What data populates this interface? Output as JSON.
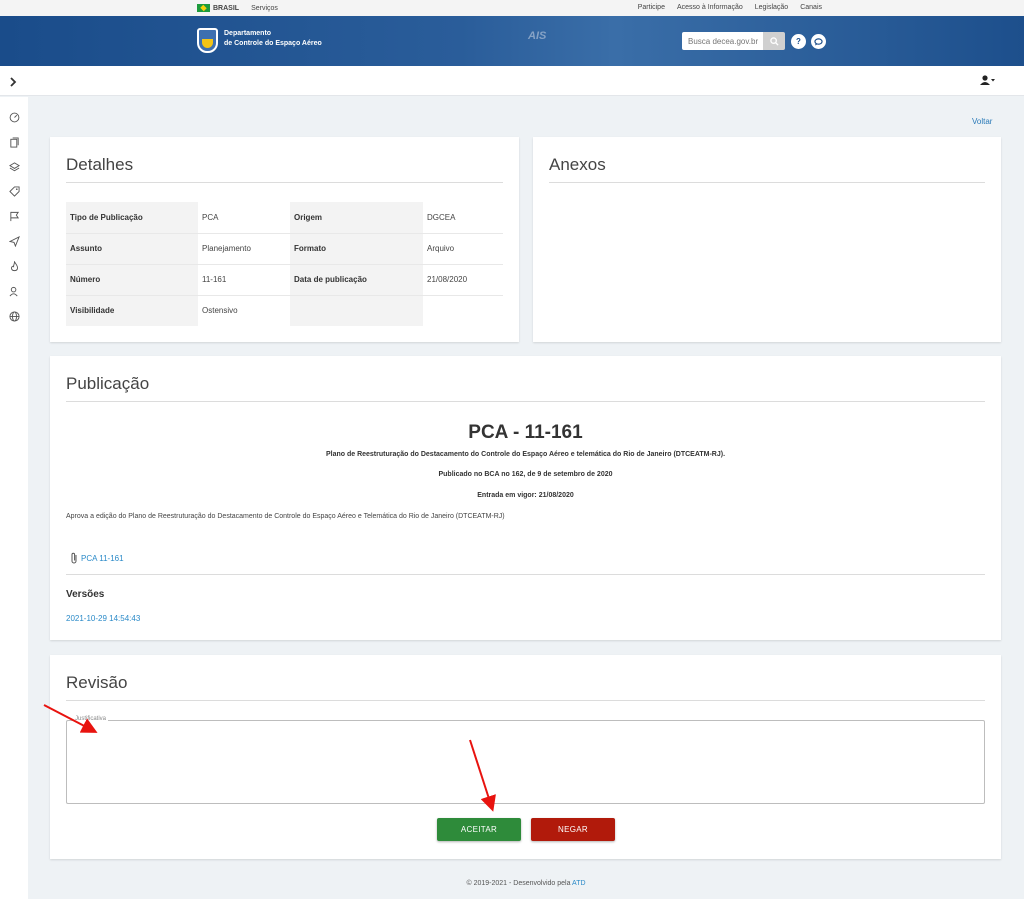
{
  "govbar": {
    "brasil": "BRASIL",
    "servicos": "Serviços",
    "links": [
      "Participe",
      "Acesso à Informação",
      "Legislação",
      "Canais"
    ]
  },
  "header": {
    "brand_line1": "Departamento",
    "brand_line2": "de Controle do Espaço Aéreo",
    "ais": "AIS",
    "search_placeholder": "Busca decea.gov.br",
    "help_label": "?",
    "chat_label": "💬"
  },
  "appbar": {
    "toggle_icon": "chevron-right-icon",
    "user_icon": "user-icon"
  },
  "sidebar_icons": [
    "dashboard-icon",
    "documents-icon",
    "layers-icon",
    "tag-icon",
    "flag-icon",
    "send-icon",
    "fire-icon",
    "user-group-icon",
    "globe-icon"
  ],
  "voltar": "Voltar",
  "detalhes": {
    "title": "Detalhes",
    "rows": [
      {
        "k1": "Tipo de Publicação",
        "v1": "PCA",
        "k2": "Origem",
        "v2": "DGCEA"
      },
      {
        "k1": "Assunto",
        "v1": "Planejamento",
        "k2": "Formato",
        "v2": "Arquivo"
      },
      {
        "k1": "Número",
        "v1": "11-161",
        "k2": "Data de publicação",
        "v2": "21/08/2020"
      },
      {
        "k1": "Visibilidade",
        "v1": "Ostensivo",
        "k2": "",
        "v2": ""
      }
    ]
  },
  "anexos": {
    "title": "Anexos"
  },
  "publicacao": {
    "title": "Publicação",
    "doc_title": "PCA - 11-161",
    "subtitle": "Plano de Reestruturação do Destacamento do Controle do Espaço Aéreo e telemática do Rio de Janeiro (DTCEATM-RJ).",
    "published": "Publicado no BCA no 162, de 9 de setembro de 2020",
    "entrada": "Entrada em vigor: 21/08/2020",
    "description": "Aprova a edição do Plano de Reestruturação do Destacamento de Controle do Espaço Aéreo e Telemática do Rio de Janeiro (DTCEATM-RJ)",
    "attachment": "PCA 11-161",
    "versoes_label": "Versões",
    "version": "2021-10-29 14:54:43"
  },
  "revisao": {
    "title": "Revisão",
    "justificativa_label": "Justificativa",
    "justificativa_value": "",
    "accept": "ACEITAR",
    "deny": "NEGAR"
  },
  "footer": {
    "text": "© 2019-2021 - Desenvolvido pela",
    "link": "ATD"
  }
}
